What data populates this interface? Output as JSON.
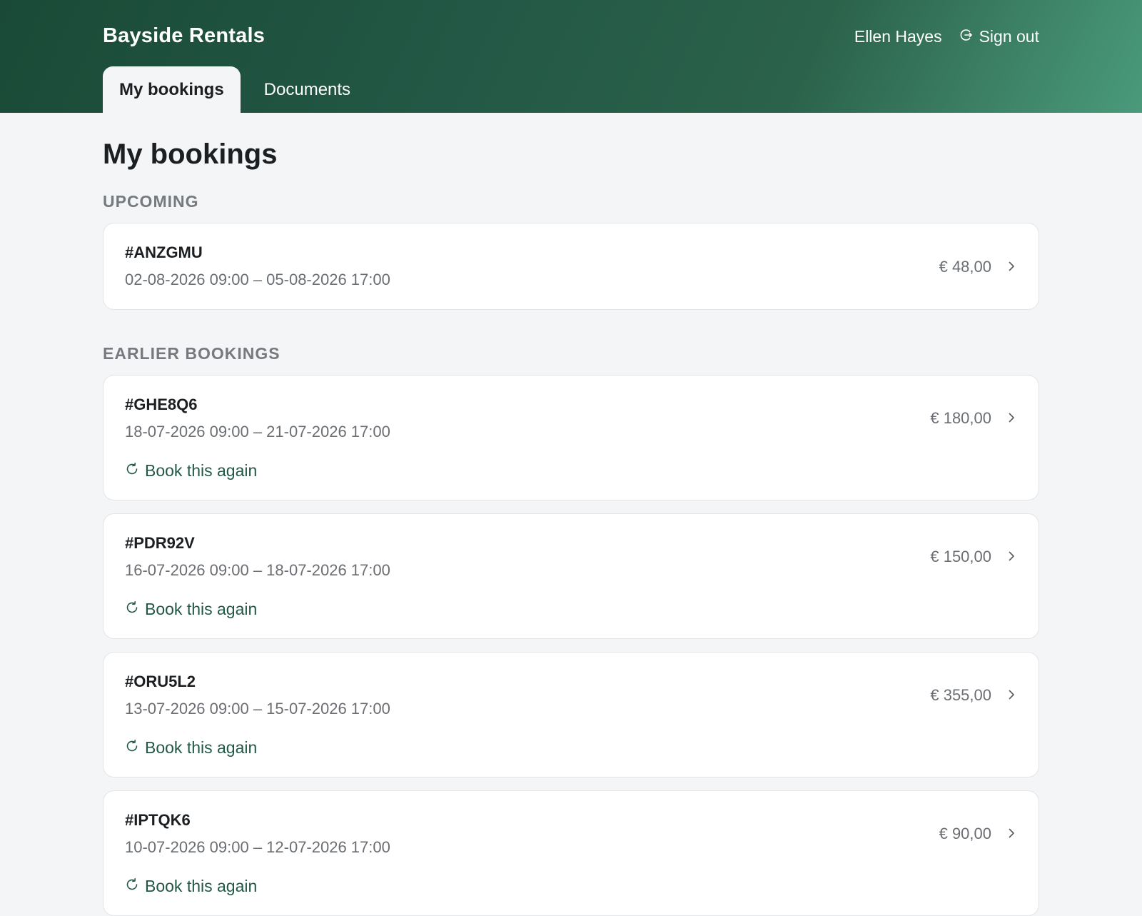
{
  "header": {
    "brand": "Bayside Rentals",
    "user_name": "Ellen Hayes",
    "sign_out_label": "Sign out",
    "tabs": [
      {
        "label": "My bookings",
        "active": true
      },
      {
        "label": "Documents",
        "active": false
      }
    ]
  },
  "main": {
    "title": "My bookings",
    "upcoming_label": "Upcoming",
    "earlier_label": "Earlier bookings",
    "rebook_label": "Book this again",
    "upcoming": [
      {
        "code": "#ANZGMU",
        "dates": "02-08-2026 09:00 – 05-08-2026 17:00",
        "price": "€ 48,00"
      }
    ],
    "earlier": [
      {
        "code": "#GHE8Q6",
        "dates": "18-07-2026 09:00 – 21-07-2026 17:00",
        "price": "€ 180,00"
      },
      {
        "code": "#PDR92V",
        "dates": "16-07-2026 09:00 – 18-07-2026 17:00",
        "price": "€ 150,00"
      },
      {
        "code": "#ORU5L2",
        "dates": "13-07-2026 09:00 – 15-07-2026 17:00",
        "price": "€ 355,00"
      },
      {
        "code": "#IPTQK6",
        "dates": "10-07-2026 09:00 – 12-07-2026 17:00",
        "price": "€ 90,00"
      }
    ]
  },
  "colors": {
    "header_dark": "#1a4a37",
    "header_light": "#4a9a7c",
    "accent": "#225845",
    "background": "#f4f5f7"
  }
}
